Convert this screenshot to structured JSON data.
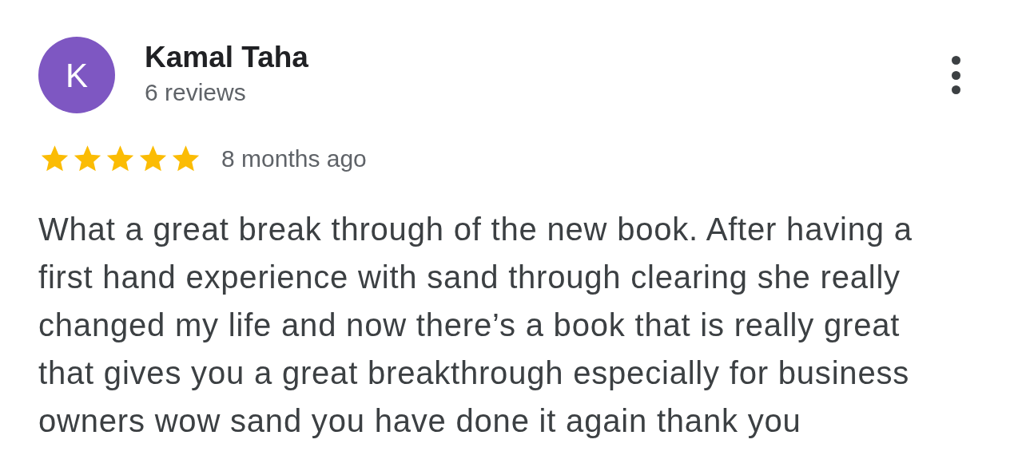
{
  "review": {
    "avatar_letter": "K",
    "author": "Kamal Taha",
    "review_count": "6 reviews",
    "stars": 5,
    "time": "8 months ago",
    "text": "What a great break through of the new book. After having a first hand experience with sand through clearing she really changed my life and now there’s a book that is really great that gives you a great breakthrough especially for business owners wow sand you have done it again thank you"
  }
}
